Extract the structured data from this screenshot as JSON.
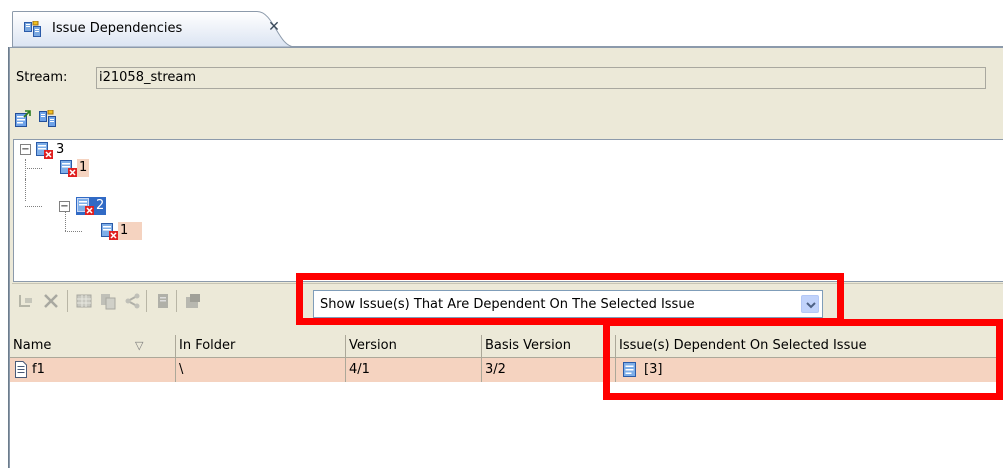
{
  "tab": {
    "title": "Issue Dependencies",
    "close_glyph": "✕",
    "icon": "issue-dependencies-icon"
  },
  "stream": {
    "label": "Stream:",
    "value": "i21058_stream"
  },
  "toolbar_top": {
    "icons": [
      "export-icon",
      "dependencies-icon"
    ]
  },
  "tree": {
    "nodes": [
      {
        "label": "3",
        "depth": 0,
        "expander": "−",
        "state": "normal"
      },
      {
        "label": "1",
        "depth": 1,
        "expander": "",
        "state": "highlight"
      },
      {
        "label": "2",
        "depth": 1,
        "expander": "−",
        "state": "selected"
      },
      {
        "label": "1",
        "depth": 2,
        "expander": "",
        "state": "highlight"
      }
    ]
  },
  "filter": {
    "selected": "Show Issue(s) That Are Dependent On The Selected Issue"
  },
  "table": {
    "sort_glyph": "▽",
    "columns": [
      "Name",
      "In Folder",
      "Version",
      "Basis Version",
      "Issue(s) Dependent On Selected Issue"
    ],
    "rows": [
      {
        "name": "f1",
        "folder": "\\",
        "version": "4/1",
        "basis": "3/2",
        "dependent": "[3]"
      }
    ]
  },
  "colors": {
    "highlight": "#ff0000",
    "selected": "#316ac5",
    "row_bg": "#f5d3c0",
    "chrome": "#ece9d8"
  }
}
